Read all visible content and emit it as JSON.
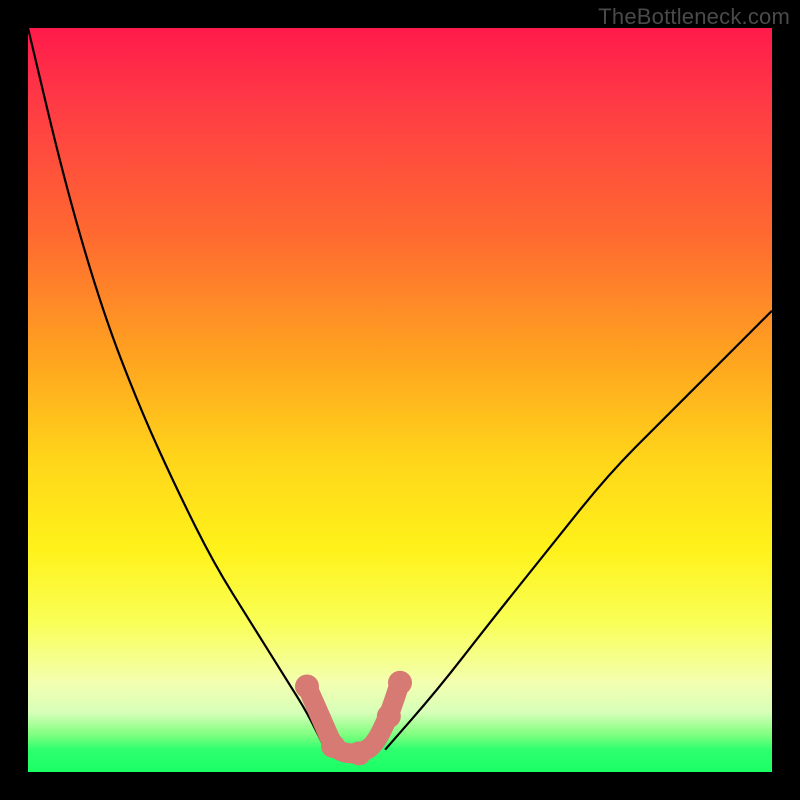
{
  "watermark": "TheBottleneck.com",
  "chart_data": {
    "type": "line",
    "title": "",
    "xlabel": "",
    "ylabel": "",
    "xlim": [
      0,
      1
    ],
    "ylim": [
      0,
      1
    ],
    "legend": false,
    "grid": false,
    "background_gradient": {
      "top": "#ff1a4b",
      "bottom": "#1aff66"
    },
    "series": [
      {
        "name": "left-curve",
        "style": "black-thin",
        "x": [
          0.0,
          0.05,
          0.1,
          0.15,
          0.2,
          0.25,
          0.3,
          0.35,
          0.375,
          0.4
        ],
        "y": [
          1.0,
          0.79,
          0.62,
          0.49,
          0.38,
          0.28,
          0.2,
          0.12,
          0.08,
          0.03
        ]
      },
      {
        "name": "right-curve",
        "style": "black-thin",
        "x": [
          0.48,
          0.55,
          0.62,
          0.7,
          0.78,
          0.86,
          0.93,
          1.0
        ],
        "y": [
          0.03,
          0.11,
          0.2,
          0.3,
          0.4,
          0.48,
          0.55,
          0.62
        ]
      },
      {
        "name": "trough-highlight",
        "style": "salmon-thick",
        "x": [
          0.375,
          0.395,
          0.41,
          0.425,
          0.445,
          0.465,
          0.485,
          0.5
        ],
        "y": [
          0.115,
          0.07,
          0.035,
          0.025,
          0.025,
          0.035,
          0.075,
          0.12
        ]
      }
    ],
    "markers": [
      {
        "series": "trough-highlight",
        "x": 0.375,
        "y": 0.115
      },
      {
        "series": "trough-highlight",
        "x": 0.41,
        "y": 0.035
      },
      {
        "series": "trough-highlight",
        "x": 0.445,
        "y": 0.025
      },
      {
        "series": "trough-highlight",
        "x": 0.485,
        "y": 0.075
      },
      {
        "series": "trough-highlight",
        "x": 0.5,
        "y": 0.12
      }
    ]
  }
}
